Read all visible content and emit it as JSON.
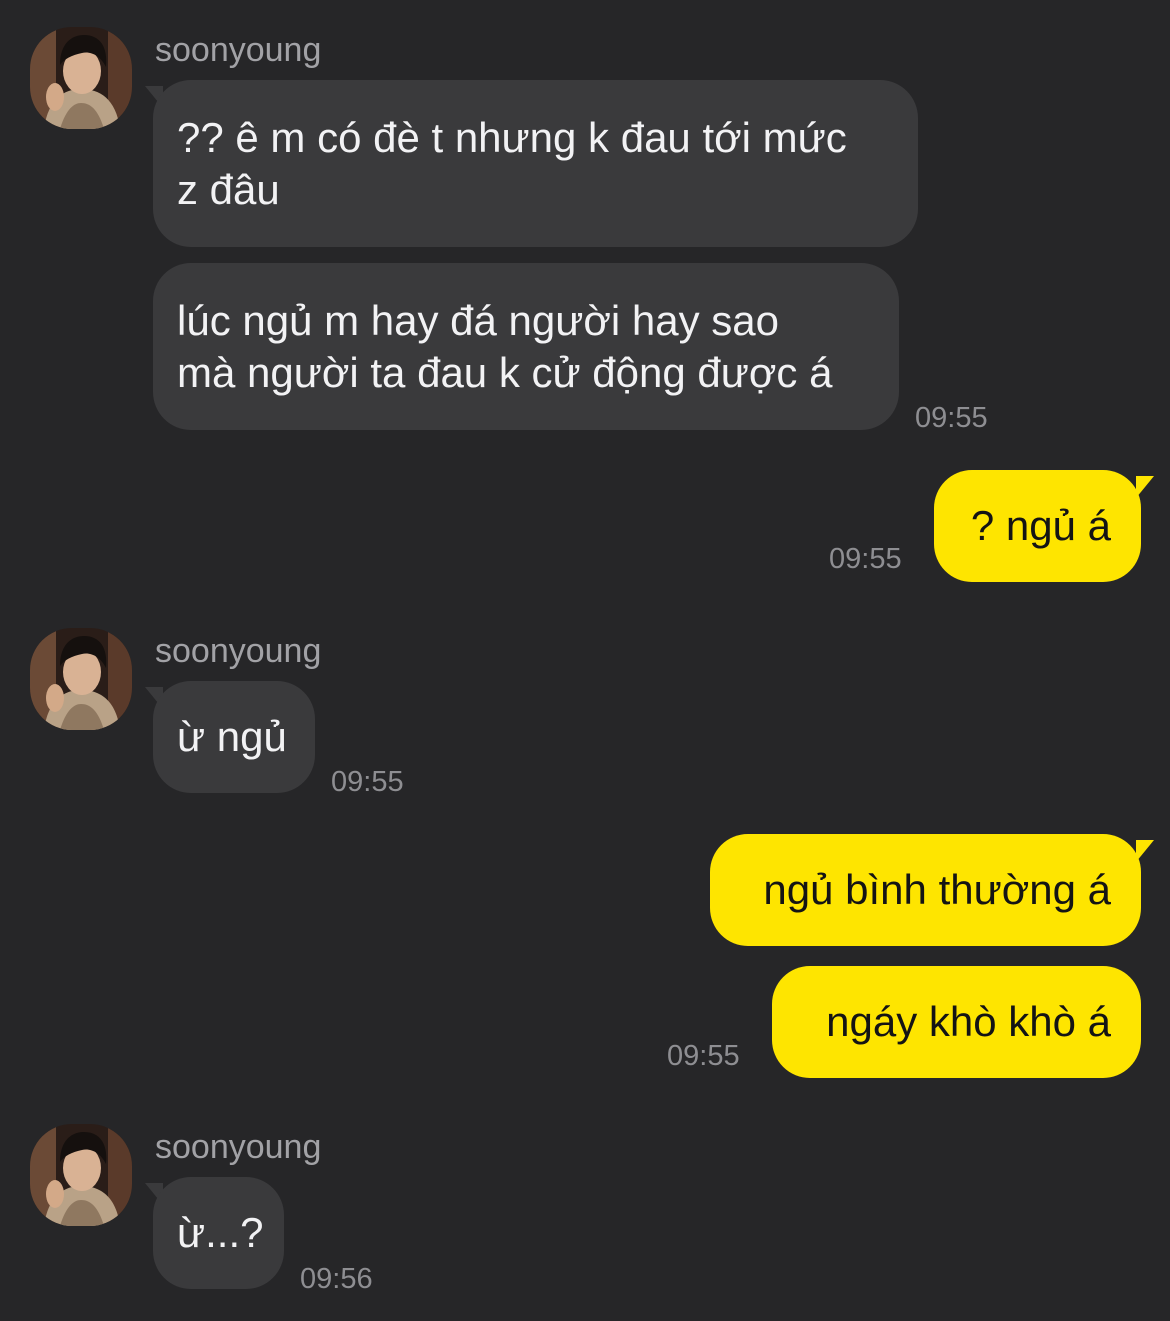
{
  "contact": {
    "name": "soonyoung",
    "avatar_icon": "profile-photo-avatar"
  },
  "colors": {
    "background": "#262628",
    "incoming_bubble": "#3a3a3c",
    "outgoing_bubble": "#fee500",
    "outgoing_text": "#141414",
    "incoming_text": "#f2f2f4",
    "timestamp": "#8e8e92"
  },
  "messages": [
    {
      "sender": "soonyoung",
      "bubbles": [
        {
          "lines": [
            "?? ê m có đè t nhưng k đau tới mức",
            "z đâu"
          ]
        },
        {
          "lines": [
            "lúc ngủ m hay đá người hay sao",
            "mà người ta đau k cử động được á"
          ]
        }
      ],
      "time": "09:55"
    },
    {
      "sender": "me",
      "bubbles": [
        {
          "lines": [
            "? ngủ á"
          ]
        }
      ],
      "time": "09:55"
    },
    {
      "sender": "soonyoung",
      "bubbles": [
        {
          "lines": [
            "ừ ngủ"
          ]
        }
      ],
      "time": "09:55"
    },
    {
      "sender": "me",
      "bubbles": [
        {
          "lines": [
            "ngủ bình thường á"
          ]
        },
        {
          "lines": [
            "ngáy khò khò á"
          ]
        }
      ],
      "time": "09:55"
    },
    {
      "sender": "soonyoung",
      "bubbles": [
        {
          "lines": [
            "ừ...?"
          ]
        }
      ],
      "time": "09:56"
    }
  ]
}
